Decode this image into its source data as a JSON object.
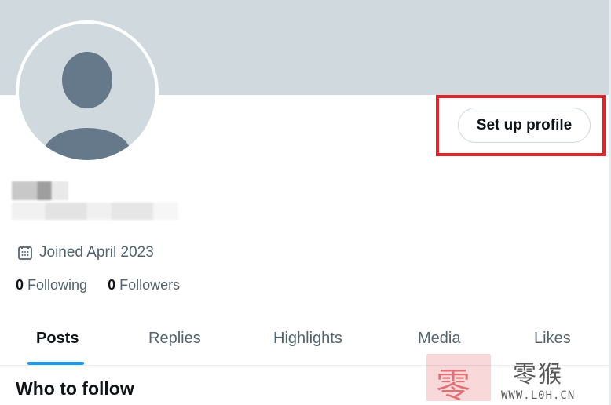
{
  "profile": {
    "setup_button_label": "Set up profile",
    "joined": "Joined April 2023",
    "following_count": "0",
    "following_label": "Following",
    "followers_count": "0",
    "followers_label": "Followers"
  },
  "tabs": [
    {
      "label": "Posts",
      "active": true
    },
    {
      "label": "Replies"
    },
    {
      "label": "Highlights"
    },
    {
      "label": "Media"
    },
    {
      "label": "Likes"
    }
  ],
  "who_to_follow": "Who to follow",
  "watermark": {
    "seal_char": "零",
    "text": "零猴",
    "url": "WWW.L0H.CN"
  },
  "colors": {
    "banner": "#cfd9de",
    "highlight": "#e0262b",
    "accent": "#1d9bf0"
  },
  "icons": {
    "joined": "calendar-icon",
    "avatar": "default-avatar-icon"
  }
}
